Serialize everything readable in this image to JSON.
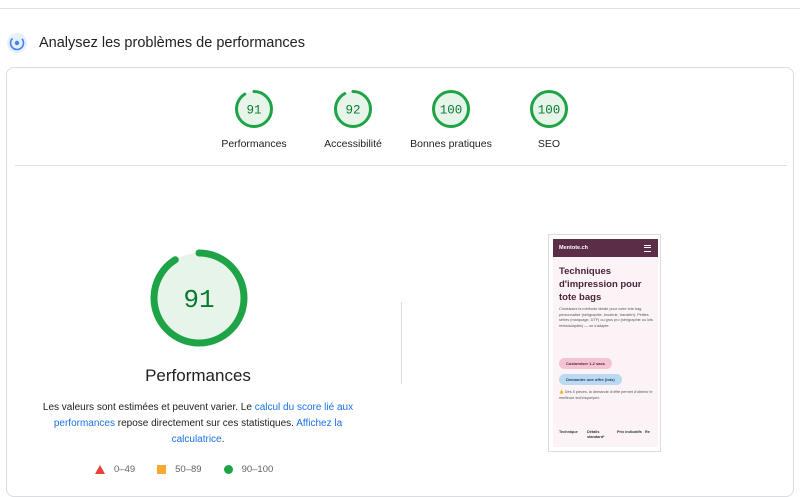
{
  "section": {
    "title": "Analysez les problèmes de performances",
    "icon": "performance-icon"
  },
  "categories": [
    {
      "score": "91",
      "label": "Performances",
      "fraction": 0.91
    },
    {
      "score": "92",
      "label": "Accessibilité",
      "fraction": 0.92
    },
    {
      "score": "100",
      "label": "Bonnes pratiques",
      "fraction": 1.0
    },
    {
      "score": "100",
      "label": "SEO",
      "fraction": 1.0
    }
  ],
  "main": {
    "score": "91",
    "fraction": 0.91,
    "label": "Performances"
  },
  "description": {
    "part1": "Les valeurs sont estimées et peuvent varier. Le ",
    "link1": "calcul du score lié aux performances",
    "part2": " repose directement sur ces statistiques. ",
    "link2": "Affichez la calculatrice",
    "part3": "."
  },
  "legend": [
    {
      "range": "0–49",
      "icon": "fail-triangle-icon"
    },
    {
      "range": "50–89",
      "icon": "average-square-icon"
    },
    {
      "range": "90–100",
      "icon": "pass-circle-icon"
    }
  ],
  "colors": {
    "pass": "#1ea446",
    "pass_bg": "#e6f4ea",
    "average": "#f8a932",
    "fail": "#ea4335",
    "link": "#1a73e8"
  },
  "screenshot": {
    "brand": "Mentote.ch",
    "heading": "Techniques d'impression pour tote bags",
    "paragraph": "Choisissez la méthode idéale pour votre tote bag personnalisé (sérigraphie, broderie, transfert). Petites séries (marquage, DTF) ou gros pro (sérigraphie ou lots réels/adaptés) — on s'adapte.",
    "cta1": "Customiser 1-2 sacs",
    "cta2": "Demander une offre (lots)",
    "paragraph2": "👍 Dès 5 pièces, la demande d'offre permet d'obtenir le meilleure technique/prix.",
    "table_headers": [
      "Technique",
      "Détails standard*",
      "Prix indicatifs",
      "Re"
    ]
  }
}
